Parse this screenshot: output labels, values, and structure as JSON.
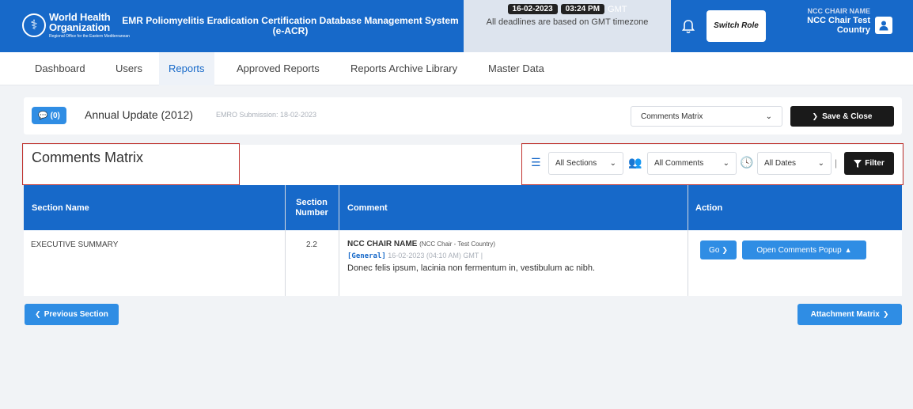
{
  "header": {
    "org_name_line1": "World Health",
    "org_name_line2": "Organization",
    "org_sub": "Regional Office for the Eastern Mediterranean",
    "app_title": "EMR Poliomyelitis Eradication Certification Database Management System (e-ACR)",
    "date": "16-02-2023",
    "time": "03:24 PM",
    "tz": "GMT",
    "deadline_note": "All deadlines are based on GMT timezone",
    "switch_role": "Switch Role",
    "user_top": "NCC CHAIR NAME",
    "user_line1": "NCC Chair Test",
    "user_line2": "Country",
    "accent": "#1769c9"
  },
  "nav": {
    "items": [
      "Dashboard",
      "Users",
      "Reports",
      "Approved Reports",
      "Reports Archive Library",
      "Master Data"
    ],
    "active": "Reports"
  },
  "report": {
    "comments_count": "(0)",
    "title": "Annual Update (2012)",
    "submission": "EMRO Submission: 18-02-2023",
    "view_select": "Comments Matrix",
    "save_close": "Save & Close"
  },
  "matrix": {
    "title": "Comments Matrix",
    "filters": {
      "sections": "All Sections",
      "comments": "All Comments",
      "dates": "All Dates",
      "filter_btn": "Filter"
    },
    "columns": {
      "section_name": "Section Name",
      "section_number": "Section Number",
      "comment": "Comment",
      "action": "Action"
    },
    "rows": [
      {
        "section_name": "EXECUTIVE SUMMARY",
        "section_number": "2.2",
        "commenter": "NCC CHAIR NAME",
        "commenter_role": "(NCC Chair - Test Country)",
        "tag": "[General]",
        "timestamp": "16-02-2023 (04:10 AM) GMT |",
        "text": "Donec felis ipsum, lacinia non fermentum in, vestibulum ac nibh.",
        "go": "Go",
        "popup": "Open Comments Popup"
      }
    ]
  },
  "footer": {
    "prev": "Previous Section",
    "next": "Attachment Matrix"
  }
}
